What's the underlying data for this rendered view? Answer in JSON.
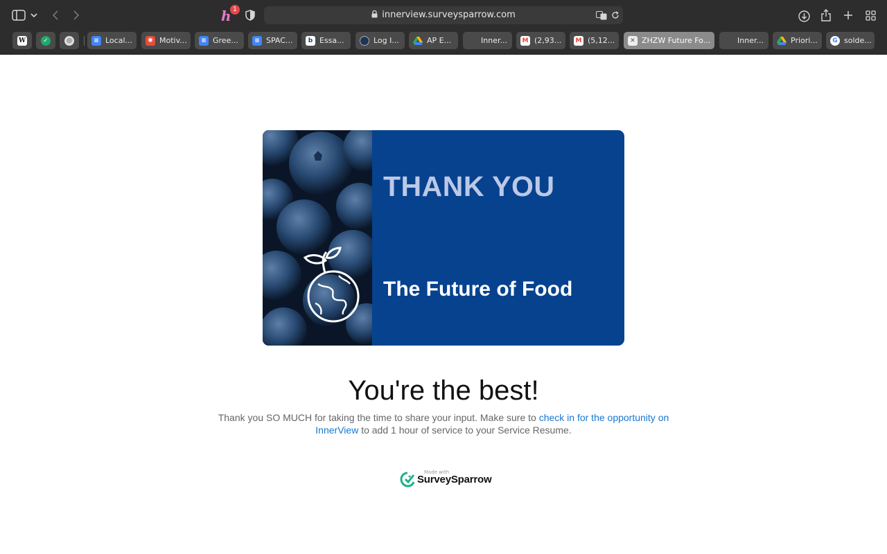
{
  "browser": {
    "url": "innerview.surveysparrow.com",
    "honey_badge": "1",
    "bookmarks": [
      {
        "label": "",
        "icon": "wikipedia-icon"
      },
      {
        "label": "",
        "icon": "shield-check-icon"
      },
      {
        "label": "",
        "icon": "globe-grid-icon"
      },
      {
        "label": "Local...",
        "icon": "docs-icon"
      },
      {
        "label": "Motiv...",
        "icon": "motiv-icon"
      },
      {
        "label": "Gree...",
        "icon": "docs-icon"
      },
      {
        "label": "SPAC...",
        "icon": "docs-icon"
      },
      {
        "label": "Essa...",
        "icon": "b-icon"
      },
      {
        "label": "Log I...",
        "icon": "circle-icon"
      },
      {
        "label": "AP E...",
        "icon": "drive-icon"
      },
      {
        "label": "Inner...",
        "icon": "blank-icon"
      },
      {
        "label": "(2,93...",
        "icon": "gmail-icon"
      },
      {
        "label": "(5,12...",
        "icon": "gmail-icon"
      },
      {
        "label": "ZHZW Future Fo...",
        "icon": "close-square-icon"
      },
      {
        "label": "Inner...",
        "icon": "blank-icon"
      },
      {
        "label": "Priori...",
        "icon": "drive-icon"
      },
      {
        "label": "solde...",
        "icon": "google-icon"
      }
    ]
  },
  "banner": {
    "heading": "THANK YOU",
    "subheading": "The Future of Food",
    "photo_icon": "globe-sprout-icon"
  },
  "main": {
    "headline": "You're the best!",
    "message_before": "Thank you SO MUCH for taking the time to share your input. Make sure to ",
    "message_link": "check in for the opportunity on InnerView",
    "message_after": " to add 1 hour of service to your Service Resume."
  },
  "footer": {
    "made_with": "Made with",
    "brand": "SurveySparrow"
  },
  "colors": {
    "banner_blue": "#07428f",
    "link_blue": "#1677d2",
    "brand_green": "#1bb189"
  }
}
